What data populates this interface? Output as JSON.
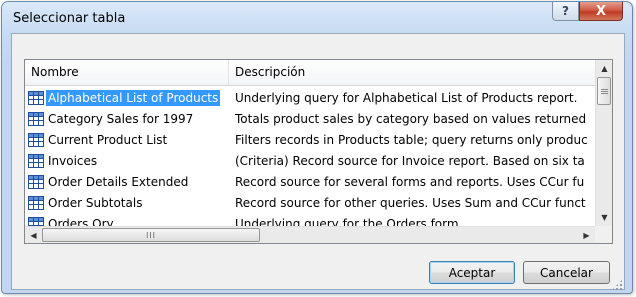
{
  "window": {
    "title": "Seleccionar tabla",
    "help_label": "?",
    "close_label": "X"
  },
  "list": {
    "columns": [
      "Nombre",
      "Descripción"
    ],
    "selected_index": 0,
    "rows": [
      {
        "name": "Alphabetical List of Products",
        "description": "Underlying query for Alphabetical List of Products report."
      },
      {
        "name": "Category Sales for 1997",
        "description": "Totals product sales by category based on values returned"
      },
      {
        "name": "Current Product List",
        "description": "Filters records in Products table; query returns only produc"
      },
      {
        "name": "Invoices",
        "description": "(Criteria) Record source for Invoice report. Based on six ta"
      },
      {
        "name": "Order Details Extended",
        "description": "Record source for several forms and reports. Uses CCur fu"
      },
      {
        "name": "Order Subtotals",
        "description": "Record source for other queries. Uses Sum and CCur funct"
      },
      {
        "name": "Orders Qry",
        "description": "Underlying query for the Orders form."
      }
    ],
    "row_icon": "table-icon",
    "hscroll_grip": "III"
  },
  "buttons": {
    "ok_label": "Aceptar",
    "cancel_label": "Cancelar"
  },
  "colors": {
    "selection": "#3399ff",
    "title_bar": "#c7dbf2",
    "close_button": "#c03a22"
  }
}
